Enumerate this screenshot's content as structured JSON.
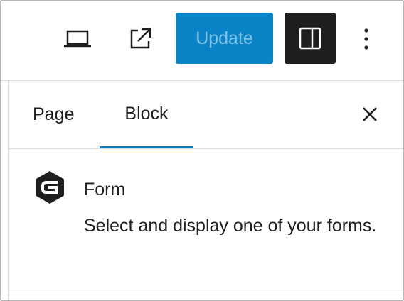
{
  "toolbar": {
    "preview_icon": "laptop-icon",
    "view_post_icon": "external-link-icon",
    "update_label": "Update",
    "settings_icon": "sidebar-panel-icon",
    "more_icon": "more-vertical-icon",
    "update_bg": "#0a84c6",
    "settings_bg": "#1e1e1e"
  },
  "sidebar": {
    "tabs": [
      {
        "label": "Page",
        "active": false
      },
      {
        "label": "Block",
        "active": true
      }
    ],
    "close_icon": "close-icon",
    "block": {
      "icon": "gravity-forms-icon",
      "title": "Form",
      "description": "Select and display one of your forms."
    },
    "accent": "#0a7cbd"
  }
}
